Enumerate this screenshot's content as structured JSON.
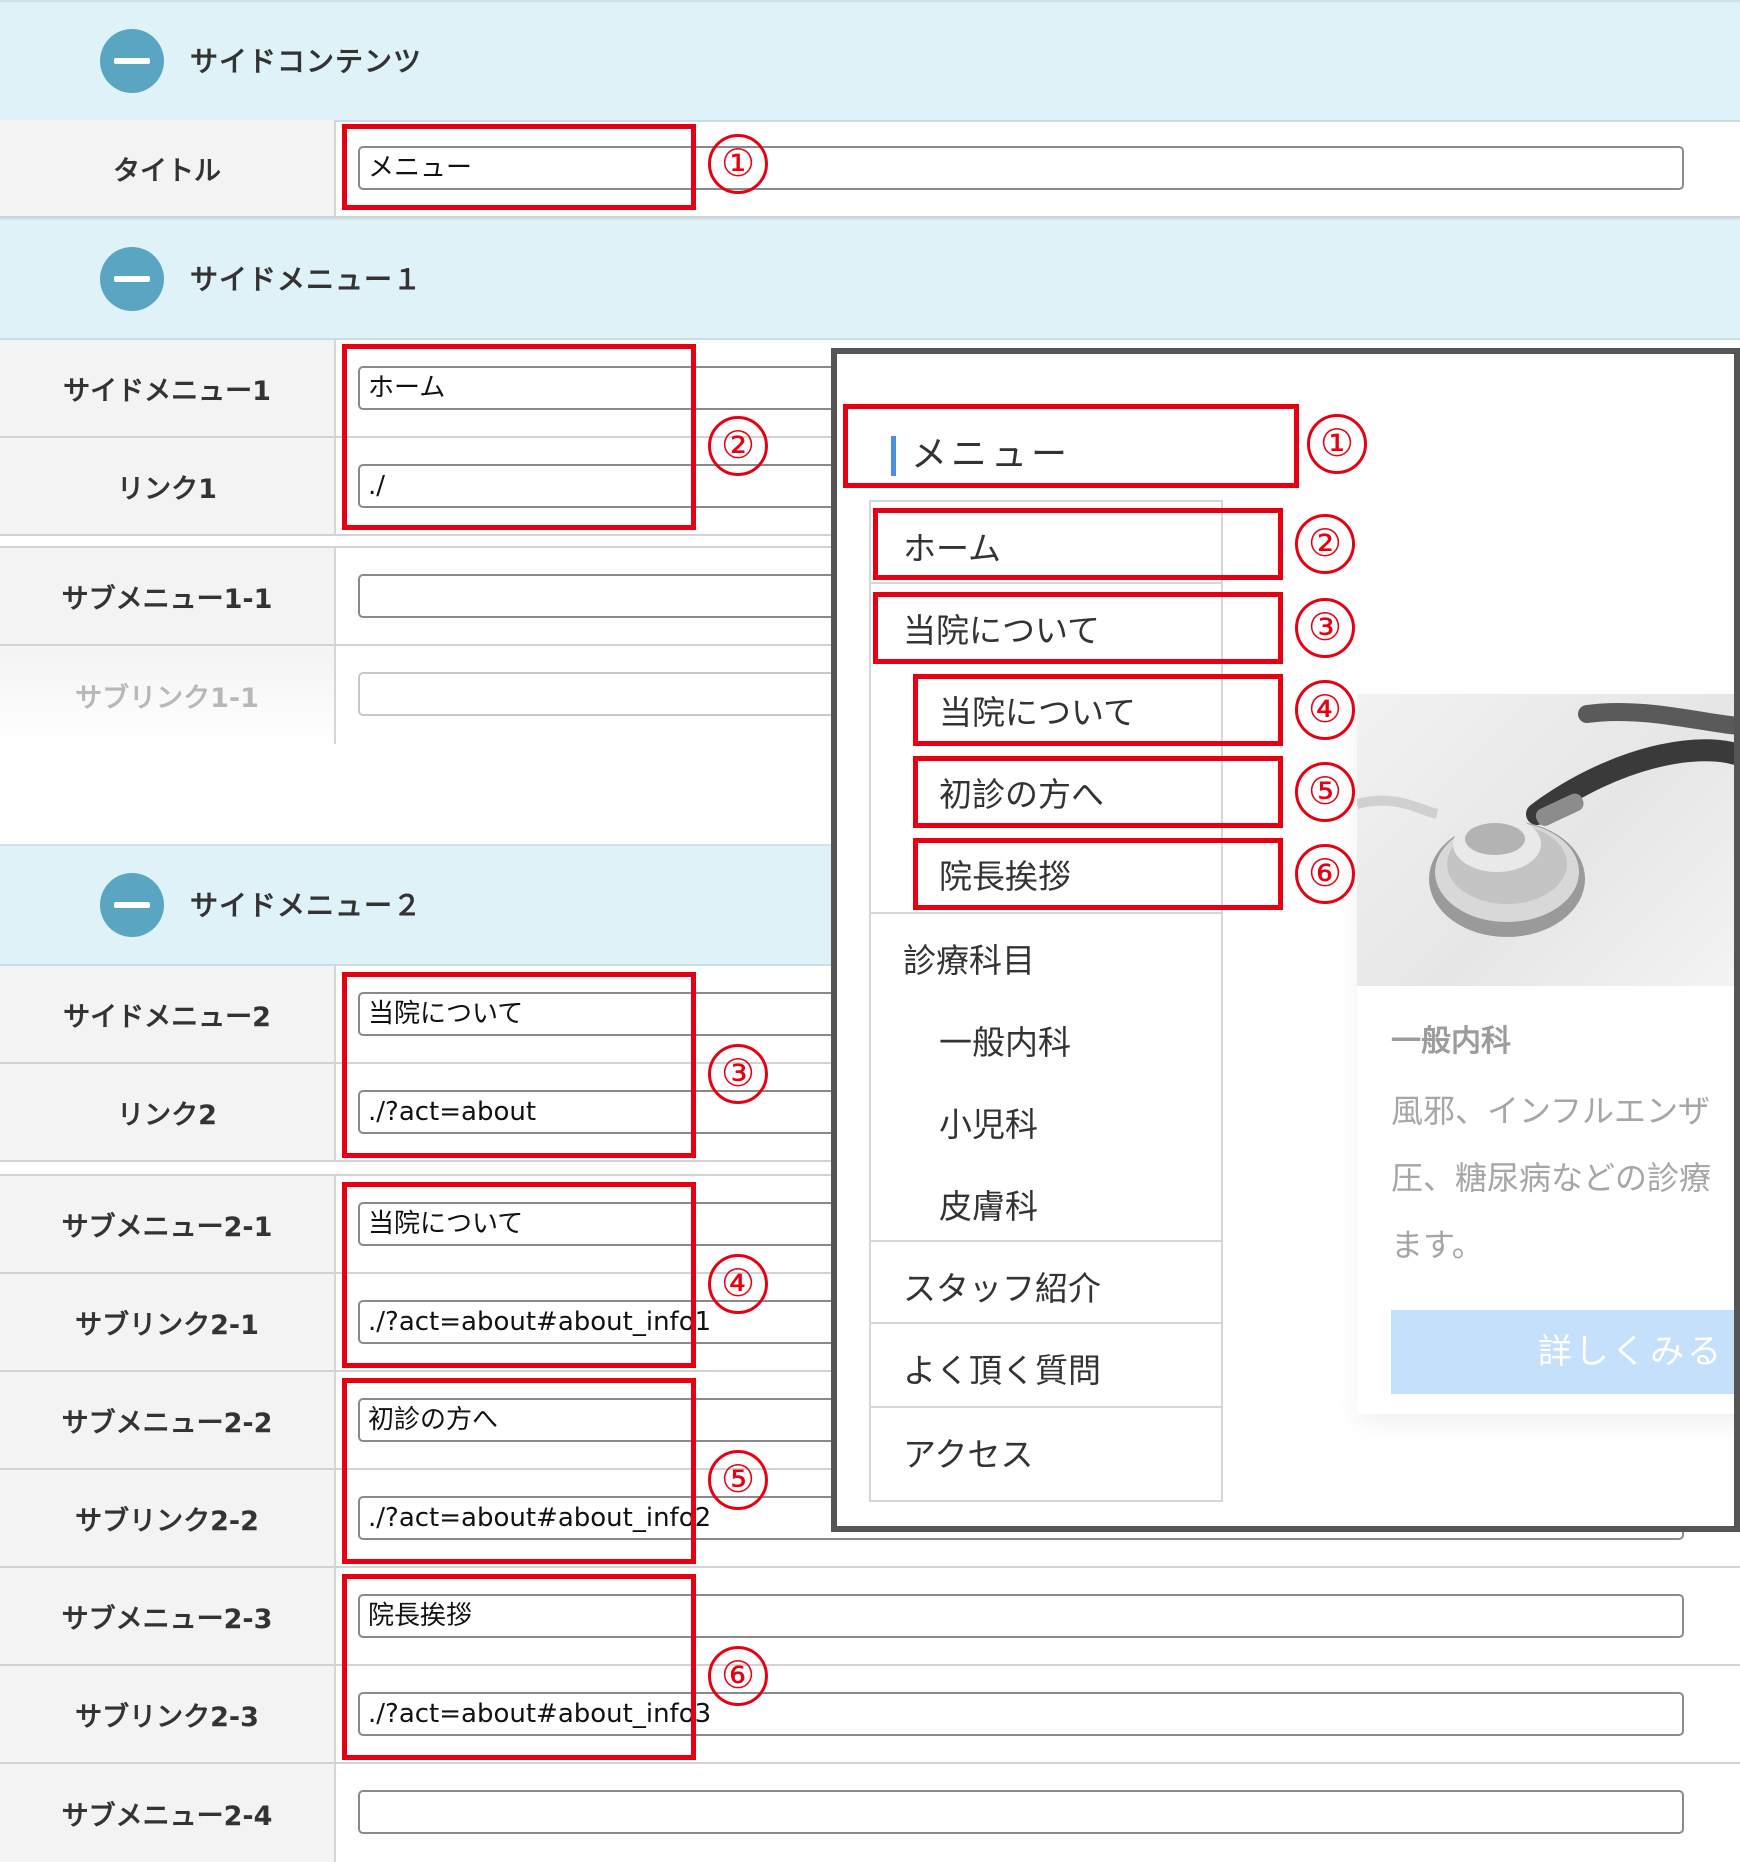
{
  "sections": {
    "side_content": {
      "title": "サイドコンテンツ"
    },
    "side_menu_1": {
      "title": "サイドメニュー１"
    },
    "side_menu_2": {
      "title": "サイドメニュー２"
    }
  },
  "rows": {
    "title": {
      "label": "タイトル",
      "value": "メニュー"
    },
    "menu1": {
      "label": "サイドメニュー1",
      "value": "ホーム"
    },
    "link1": {
      "label": "リンク1",
      "value": "./"
    },
    "submenu1_1": {
      "label": "サブメニュー1-1",
      "value": ""
    },
    "sublink1_1": {
      "label": "サブリンク1-1",
      "value": ""
    },
    "menu2": {
      "label": "サイドメニュー2",
      "value": "当院について"
    },
    "link2": {
      "label": "リンク2",
      "value": "./?act=about"
    },
    "submenu2_1": {
      "label": "サブメニュー2-1",
      "value": "当院について"
    },
    "sublink2_1": {
      "label": "サブリンク2-1",
      "value": "./?act=about#about_info1"
    },
    "submenu2_2": {
      "label": "サブメニュー2-2",
      "value": "初診の方へ"
    },
    "sublink2_2": {
      "label": "サブリンク2-2",
      "value": "./?act=about#about_info2"
    },
    "submenu2_3": {
      "label": "サブメニュー2-3",
      "value": "院長挨拶"
    },
    "sublink2_3": {
      "label": "サブリンク2-3",
      "value": "./?act=about#about_info3"
    },
    "submenu2_4": {
      "label": "サブメニュー2-4",
      "value": ""
    }
  },
  "callout_numbers": [
    "①",
    "②",
    "③",
    "④",
    "⑤",
    "⑥"
  ],
  "preview": {
    "menu_title": "メニュー",
    "items": [
      {
        "label": "ホーム",
        "level": "top"
      },
      {
        "label": "当院について",
        "level": "top"
      },
      {
        "label": "当院について",
        "level": "sub"
      },
      {
        "label": "初診の方へ",
        "level": "sub"
      },
      {
        "label": "院長挨拶",
        "level": "sub"
      },
      {
        "label": "診療科目",
        "level": "top"
      },
      {
        "label": "一般内科",
        "level": "sub"
      },
      {
        "label": "小児科",
        "level": "sub"
      },
      {
        "label": "皮膚科",
        "level": "sub"
      },
      {
        "label": "スタッフ紹介",
        "level": "top"
      },
      {
        "label": "よく頂く質問",
        "level": "top"
      },
      {
        "label": "アクセス",
        "level": "top"
      }
    ],
    "card": {
      "title": "一般内科",
      "text_lines": [
        "風邪、インフルエンザ",
        "圧、糖尿病などの診療",
        "ます。"
      ],
      "button": "詳しくみる"
    }
  },
  "colors": {
    "header_bg": "#dff2f8",
    "toggle": "#5aa6c2",
    "callout_red": "#e60012",
    "menu_accent": "#4a8fe0",
    "button_bg": "#c5e0fb"
  },
  "icons": {
    "section_toggle": "minus-circle-icon",
    "card_image": "stethoscope-photo"
  }
}
